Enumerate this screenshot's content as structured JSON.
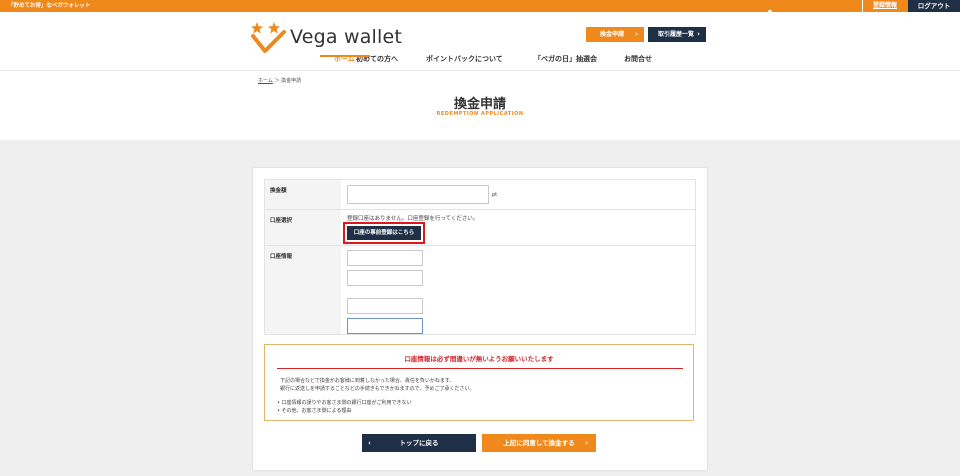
{
  "topbar": {
    "tagline": "「貯めてお得」なベガウォレット",
    "register_link": "登録情報",
    "logout": "ログアウト"
  },
  "header": {
    "logo_text": "Vega wallet",
    "apply_button": "換金申請",
    "history_button": "取引履歴一覧"
  },
  "nav": {
    "items": [
      {
        "label": "ホーム",
        "active": true
      },
      {
        "label": "初めての方へ",
        "active": false
      },
      {
        "label": "ポイントバックについて",
        "active": false
      },
      {
        "label": "「ベガの日」抽選会",
        "active": false
      },
      {
        "label": "お問合せ",
        "active": false
      }
    ]
  },
  "breadcrumb": {
    "home": "ホーム",
    "separator": "＞",
    "current": "換金申請"
  },
  "page": {
    "title": "換金申請",
    "subtitle": "REDEMPTION APPLICATION"
  },
  "form": {
    "amount_label": "換金額",
    "amount_value": "",
    "amount_unit": "pt",
    "account_label": "口座選択",
    "account_message": "登録口座はありません。口座登録を行ってください。",
    "register_account_button": "口座の事前登録はこちら",
    "info_label": "口座情報",
    "info_fields": [
      "",
      "",
      "",
      ""
    ]
  },
  "notice": {
    "title": "口座情報は必ず間違いが無いようお願いいたします",
    "line1": "下記の場合などで換金がお客様に到着しなかった場合、責任を負いかねます。",
    "line2": "銀行に返送しを申請することなどの手続きもできかねますので、予めご了承ください。",
    "bullets": [
      "口座情報の誤りやお客さま側の銀行口座がご利用できない",
      "その他、お客さま側による理由"
    ]
  },
  "actions": {
    "back_button": "トップに戻る",
    "agree_button": "上記に同意して換金する"
  },
  "colors": {
    "accent": "#f0891c",
    "navy": "#1f3046",
    "alert": "#d6262c"
  }
}
